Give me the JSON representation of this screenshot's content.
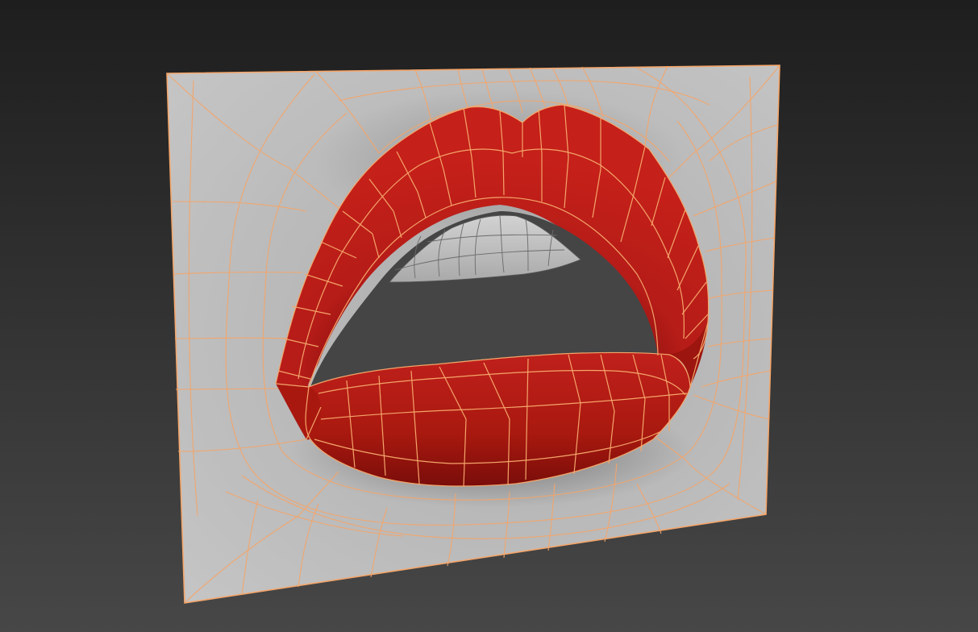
{
  "viewport": {
    "background_top": "#1e1e1e",
    "background_bottom": "#474747"
  },
  "model": {
    "subject": "lips",
    "plane_color": "#bdbdbd",
    "wire_color": "#f4a56a",
    "lip_color": "#b81c18",
    "lip_shadow": "#5a0706",
    "teeth_color": "#c4c4c4",
    "mouth_interior": "#454545",
    "selected": true
  }
}
